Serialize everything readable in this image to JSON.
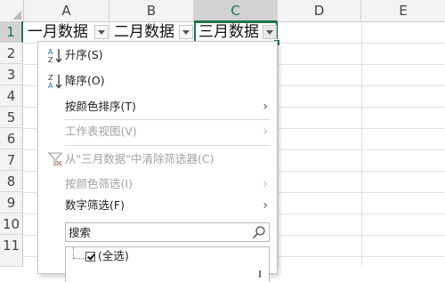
{
  "columns": [
    "A",
    "B",
    "C",
    "D",
    "E"
  ],
  "rows": [
    "1",
    "2",
    "3",
    "4",
    "5",
    "6",
    "7",
    "8",
    "9",
    "10",
    "11"
  ],
  "cells": {
    "a1": "一月数据",
    "b1": "二月数据",
    "c1": "三月数据"
  },
  "menu": {
    "sort_asc": "升序(S)",
    "sort_desc": "降序(O)",
    "sort_by_color": "按颜色排序(T)",
    "sheet_view": "工作表视图(V)",
    "clear_filter": "从\"三月数据\"中清除筛选器(C)",
    "filter_by_color": "按颜色筛选(I)",
    "number_filters": "数字筛选(F)",
    "search_placeholder": "搜索",
    "select_all": "(全选)",
    "submenu_arrow": "›"
  },
  "colors": {
    "accent_green": "#217346",
    "sort_icon_blue": "#2b6cc4"
  },
  "icons": {
    "sort_asc": "sort-ascending-icon",
    "sort_desc": "sort-descending-icon",
    "clear_filter": "clear-filter-icon",
    "search": "search-icon"
  }
}
